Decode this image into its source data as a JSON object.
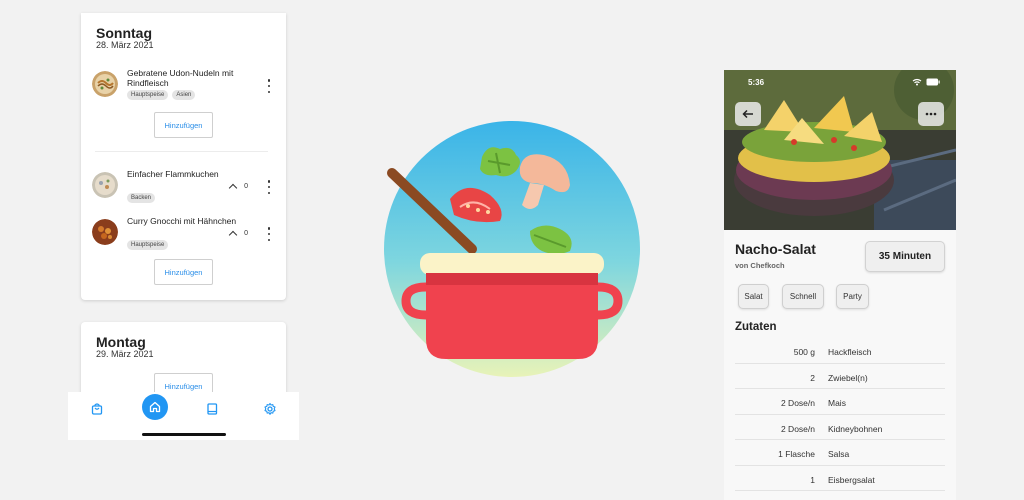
{
  "left_app": {
    "days": [
      {
        "title": "Sonntag",
        "date": "28. März 2021",
        "meals": [
          {
            "name": "Gebratene Udon-Nudeln mit Rindfleisch",
            "tags": [
              "Hauptspeise",
              "Asien"
            ]
          }
        ],
        "add_label": "Hinzufügen",
        "suggestions": [
          {
            "name": "Einfacher Flammkuchen",
            "tags": [
              "Backen"
            ],
            "votes": "0"
          },
          {
            "name": "Curry Gnocchi mit Hähnchen",
            "tags": [
              "Hauptspeise"
            ],
            "votes": "0"
          }
        ],
        "suggestions_add_label": "Hinzufügen"
      },
      {
        "title": "Montag",
        "date": "29. März 2021",
        "add_label": "Hinzufügen"
      }
    ],
    "nav": [
      "shopping-bag-icon",
      "home-icon",
      "book-icon",
      "settings-icon"
    ],
    "accent_color": "#2196f3"
  },
  "right_app": {
    "status_time": "5:36",
    "recipe": {
      "title": "Nacho-Salat",
      "author": "von Chefkoch",
      "time": "35 Minuten",
      "categories": [
        "Salat",
        "Schnell",
        "Party"
      ],
      "ingredients_heading": "Zutaten",
      "ingredients": [
        {
          "amount": "500 g",
          "name": "Hackfleisch"
        },
        {
          "amount": "2",
          "name": "Zwiebel(n)"
        },
        {
          "amount": "2 Dose/n",
          "name": "Mais"
        },
        {
          "amount": "2 Dose/n",
          "name": "Kidneybohnen"
        },
        {
          "amount": "1 Flasche",
          "name": "Salsa"
        },
        {
          "amount": "1",
          "name": "Eisbergsalat"
        }
      ]
    }
  }
}
